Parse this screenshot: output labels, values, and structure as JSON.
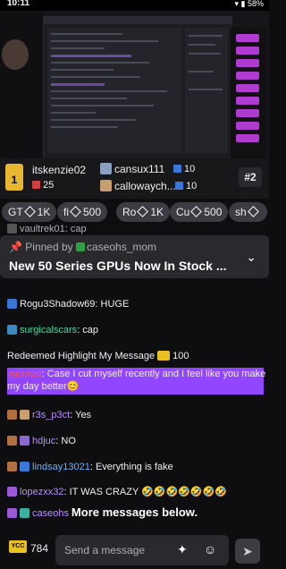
{
  "status_bar": {
    "time": "10:11",
    "battery": "58%"
  },
  "leaderboard": {
    "entries": [
      {
        "rank": "1",
        "name": "itskenzie02",
        "gifts": "25"
      },
      {
        "name": "cansux111",
        "gifts": "10"
      },
      {
        "name": "callowaych...",
        "gifts": "10"
      }
    ],
    "rank_badge": "#2"
  },
  "chips": [
    {
      "label": "GT",
      "value": "1K"
    },
    {
      "label": "fi",
      "value": "500"
    },
    {
      "label": "Ro",
      "value": "1K"
    },
    {
      "label": "Cu",
      "value": "500"
    },
    {
      "label": "sh",
      "value": ""
    }
  ],
  "partial_top_message": "vaultrek01: cap",
  "pinned": {
    "prefix": "Pinned by",
    "by": "caseohs_mom",
    "text": "New 50 Series GPUs Now In Stock ..."
  },
  "messages": [
    {
      "user": "Rogu3Shadow69",
      "text": ": HUGE"
    },
    {
      "user": "surgicalscars",
      "text": ": cap"
    },
    {
      "system": "Redeemed Highlight My Message",
      "cost": "100"
    },
    {
      "user": "vurxxed",
      "text": ": Case I cut myself recently and I feel like you make my day better😊"
    },
    {
      "user": "r3s_p3ct",
      "text": ": Yes"
    },
    {
      "user": "hdjuc",
      "text": ": NO"
    },
    {
      "user": "lindsay13021",
      "text": ": Everything is fake"
    },
    {
      "user": "lopezxx32",
      "text": ": IT WAS CRAZY 🤣🤣🤣🤣🤣🤣🤣"
    },
    {
      "user": "caseohs"
    }
  ],
  "more_messages": "More messages below.",
  "bottom": {
    "currency": "YCC",
    "points": "784",
    "placeholder": "Send a message"
  },
  "colors": {
    "accent": "#9147ff",
    "pin_bg": "#2a2a2e",
    "chip_bg": "#3c3c42",
    "bg": "#0e0e10"
  }
}
